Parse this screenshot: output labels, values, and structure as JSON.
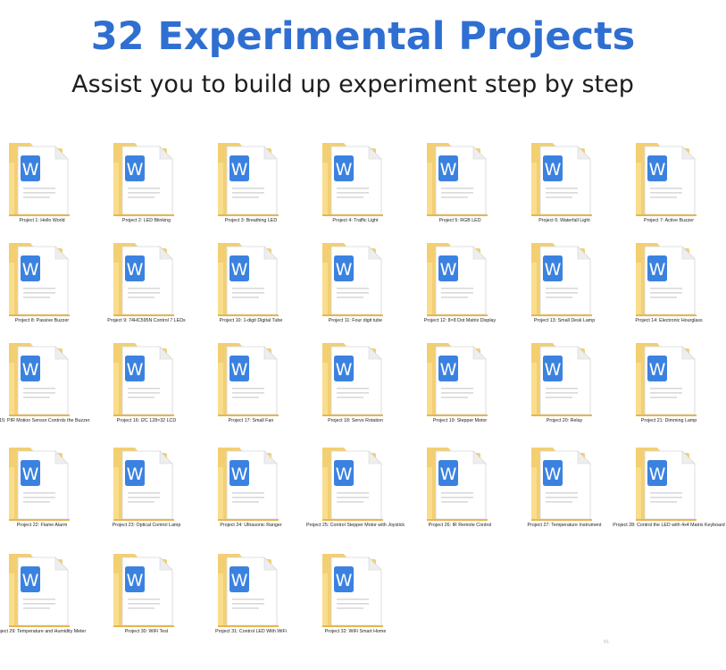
{
  "header": {
    "title": "32 Experimental Projects",
    "subtitle": "Assist you to build up experiment step by step"
  },
  "colors": {
    "title": "#2f6fd2",
    "folder_back": "#f3cf72",
    "folder_front": "#f9dd8c",
    "doc_badge": "#3b82e0"
  },
  "icon": "folder-with-word-document-icon",
  "files": [
    "Project 1:  Hello World",
    "Project 2:  LED Blinking",
    "Project 3:  Breathing LED",
    "Project 4:  Traffic Light",
    "Project 5:  RGB LED",
    "Project 6:  Waterfall Light",
    "Project 7:  Active Buzzer",
    "Project 8:  Passive Buzzer",
    "Project 9:  74HC595N Control 7 LEDs",
    "Project 10:  1-digit Digital Tube",
    "Project 11:  Four digit tube",
    "Project 12:  8×8 Dot Matrix Display",
    "Project 13:  Small Desk Lamp",
    "Project 14:  Electronic Hourglass",
    "ct 15:  PIR Motion Sensor Controls the Buzzer",
    "Project 16:  I2C 128×32 LCD",
    "Project 17:  Small Fan",
    "Project 18:  Servo Rotation",
    "Project 19:  Stepper Motor",
    "Project 20:  Relay",
    "Project 21:  Dimming Lamp",
    "Project 22:  Flame Alarm",
    "Project 23:  Optical Control Lamp",
    "Project 24:  Ultrasonic Ranger",
    "Project 25:  Control Stepper Motor with Joystick",
    "Project 26:  IR Remote Control",
    "Project 27:  Temperature Instrument",
    "Project 28:  Control the LED with 4x4 Matrix Keyboard",
    "oject 29:  Temperature and Humidity Meter",
    "Project 30:  WiFi Test",
    "Project 31:  Control LED With WiFi",
    "Project 32:  WiFi Smart Home"
  ],
  "watermark": "RL"
}
